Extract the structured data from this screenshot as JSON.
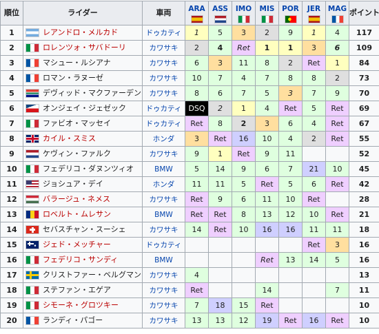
{
  "headers": {
    "pos": "順位",
    "rider": "ライダー",
    "bike": "車両",
    "points": "ポイント",
    "rounds": [
      {
        "label": "ARA",
        "flag": "f-esp",
        "flag_icon": "spain-flag-icon"
      },
      {
        "label": "ASS",
        "flag": "f-nld",
        "flag_icon": "netherlands-flag-icon"
      },
      {
        "label": "IMO",
        "flag": "f-ita",
        "flag_icon": "italy-flag-icon"
      },
      {
        "label": "MIS",
        "flag": "f-ita",
        "flag_icon": "italy-flag-icon"
      },
      {
        "label": "POR",
        "flag": "f-prt",
        "flag_icon": "portugal-flag-icon"
      },
      {
        "label": "JER",
        "flag": "f-esp",
        "flag_icon": "spain-flag-icon"
      },
      {
        "label": "MAG",
        "flag": "f-fra",
        "flag_icon": "france-flag-icon"
      }
    ]
  },
  "rows": [
    {
      "pos": "1",
      "flag": "f-arg",
      "flag_icon": "argentina-flag-icon",
      "rider": "レアンドロ・メルカド",
      "link": "link",
      "bike": "ドゥカティ",
      "points": "117",
      "results": [
        {
          "v": "1",
          "c": "c-gold",
          "s": "i"
        },
        {
          "v": "5",
          "c": "c-pts"
        },
        {
          "v": "3",
          "c": "c-bronze"
        },
        {
          "v": "2",
          "c": "c-silver"
        },
        {
          "v": "9",
          "c": "c-pts"
        },
        {
          "v": "1",
          "c": "c-gold",
          "s": "i"
        },
        {
          "v": "4",
          "c": "c-pts"
        }
      ]
    },
    {
      "pos": "2",
      "flag": "f-ita",
      "flag_icon": "italy-flag-icon",
      "rider": "ロレンツォ・サバドーリ",
      "link": "link",
      "bike": "カワサキ",
      "points": "109",
      "results": [
        {
          "v": "2",
          "c": "c-silver"
        },
        {
          "v": "4",
          "c": "c-pts",
          "s": "b"
        },
        {
          "v": "Ret",
          "c": "c-ret",
          "s": "i"
        },
        {
          "v": "1",
          "c": "c-gold",
          "s": "b"
        },
        {
          "v": "1",
          "c": "c-gold",
          "s": "b"
        },
        {
          "v": "3",
          "c": "c-bronze"
        },
        {
          "v": "6",
          "c": "c-pts",
          "s": "b i"
        }
      ]
    },
    {
      "pos": "3",
      "flag": "f-fra",
      "flag_icon": "france-flag-icon",
      "rider": "マシュー・ルシアナ",
      "link": "plain",
      "bike": "カワサキ",
      "points": "84",
      "results": [
        {
          "v": "6",
          "c": "c-pts"
        },
        {
          "v": "3",
          "c": "c-bronze"
        },
        {
          "v": "11",
          "c": "c-pts"
        },
        {
          "v": "8",
          "c": "c-pts"
        },
        {
          "v": "2",
          "c": "c-silver"
        },
        {
          "v": "Ret",
          "c": "c-ret"
        },
        {
          "v": "1",
          "c": "c-gold"
        }
      ]
    },
    {
      "pos": "4",
      "flag": "f-fra",
      "flag_icon": "france-flag-icon",
      "rider": "ロマン・ラヌーゼ",
      "link": "plain",
      "bike": "カワサキ",
      "points": "73",
      "results": [
        {
          "v": "10",
          "c": "c-pts"
        },
        {
          "v": "7",
          "c": "c-pts"
        },
        {
          "v": "4",
          "c": "c-pts"
        },
        {
          "v": "7",
          "c": "c-pts"
        },
        {
          "v": "8",
          "c": "c-pts"
        },
        {
          "v": "8",
          "c": "c-pts"
        },
        {
          "v": "2",
          "c": "c-silver"
        }
      ]
    },
    {
      "pos": "5",
      "flag": "f-zaf",
      "flag_icon": "south-africa-flag-icon",
      "rider": "デヴィッド・マクファーデン",
      "link": "plain",
      "bike": "カワサキ",
      "points": "70",
      "results": [
        {
          "v": "8",
          "c": "c-pts"
        },
        {
          "v": "6",
          "c": "c-pts"
        },
        {
          "v": "7",
          "c": "c-pts"
        },
        {
          "v": "5",
          "c": "c-pts"
        },
        {
          "v": "3",
          "c": "c-bronze",
          "s": "i"
        },
        {
          "v": "7",
          "c": "c-pts"
        },
        {
          "v": "9",
          "c": "c-pts"
        }
      ]
    },
    {
      "pos": "6",
      "flag": "f-cze",
      "flag_icon": "czech-flag-icon",
      "rider": "オンジェイ・ジェゼック",
      "link": "plain",
      "bike": "ドゥカティ",
      "points": "69",
      "results": [
        {
          "v": "DSQ",
          "c": "c-dsq"
        },
        {
          "v": "2",
          "c": "c-silver",
          "s": "i"
        },
        {
          "v": "1",
          "c": "c-gold"
        },
        {
          "v": "4",
          "c": "c-pts"
        },
        {
          "v": "Ret",
          "c": "c-ret"
        },
        {
          "v": "5",
          "c": "c-pts"
        },
        {
          "v": "Ret",
          "c": "c-ret"
        }
      ]
    },
    {
      "pos": "7",
      "flag": "f-ita",
      "flag_icon": "italy-flag-icon",
      "rider": "ファビオ・マッセイ",
      "link": "plain",
      "bike": "ドゥカティ",
      "points": "67",
      "results": [
        {
          "v": "Ret",
          "c": "c-ret"
        },
        {
          "v": "8",
          "c": "c-pts"
        },
        {
          "v": "2",
          "c": "c-silver",
          "s": "b"
        },
        {
          "v": "3",
          "c": "c-bronze"
        },
        {
          "v": "6",
          "c": "c-pts"
        },
        {
          "v": "4",
          "c": "c-pts"
        },
        {
          "v": "Ret",
          "c": "c-ret"
        }
      ]
    },
    {
      "pos": "8",
      "flag": "f-gbr",
      "flag_icon": "uk-flag-icon",
      "rider": "カイル・スミス",
      "link": "link",
      "bike": "ホンダ",
      "points": "55",
      "results": [
        {
          "v": "3",
          "c": "c-bronze"
        },
        {
          "v": "Ret",
          "c": "c-ret"
        },
        {
          "v": "16",
          "c": "c-nopts"
        },
        {
          "v": "10",
          "c": "c-pts"
        },
        {
          "v": "4",
          "c": "c-pts"
        },
        {
          "v": "2",
          "c": "c-silver"
        },
        {
          "v": "Ret",
          "c": "c-ret"
        }
      ]
    },
    {
      "pos": "9",
      "flag": "f-nld",
      "flag_icon": "netherlands-flag-icon",
      "rider": "ケヴィン・ファルク",
      "link": "plain",
      "bike": "カワサキ",
      "points": "52",
      "results": [
        {
          "v": "9",
          "c": "c-pts"
        },
        {
          "v": "1",
          "c": "c-gold"
        },
        {
          "v": "Ret",
          "c": "c-ret"
        },
        {
          "v": "9",
          "c": "c-pts"
        },
        {
          "v": "11",
          "c": "c-pts"
        },
        {
          "v": "",
          "c": "c-none"
        },
        {
          "v": "",
          "c": "c-none"
        }
      ]
    },
    {
      "pos": "10",
      "flag": "f-ita",
      "flag_icon": "italy-flag-icon",
      "rider": "フェデリコ・ダヌンツィオ",
      "link": "plain",
      "bike": "BMW",
      "points": "45",
      "results": [
        {
          "v": "5",
          "c": "c-pts"
        },
        {
          "v": "14",
          "c": "c-pts"
        },
        {
          "v": "9",
          "c": "c-pts"
        },
        {
          "v": "6",
          "c": "c-pts"
        },
        {
          "v": "7",
          "c": "c-pts"
        },
        {
          "v": "21",
          "c": "c-nopts"
        },
        {
          "v": "10",
          "c": "c-pts"
        }
      ]
    },
    {
      "pos": "11",
      "flag": "f-usa",
      "flag_icon": "usa-flag-icon",
      "rider": "ジョシュア・デイ",
      "link": "plain",
      "bike": "ホンダ",
      "points": "42",
      "results": [
        {
          "v": "11",
          "c": "c-pts"
        },
        {
          "v": "11",
          "c": "c-pts"
        },
        {
          "v": "5",
          "c": "c-pts"
        },
        {
          "v": "Ret",
          "c": "c-ret"
        },
        {
          "v": "5",
          "c": "c-pts"
        },
        {
          "v": "6",
          "c": "c-pts"
        },
        {
          "v": "Ret",
          "c": "c-ret"
        }
      ]
    },
    {
      "pos": "12",
      "flag": "f-hun",
      "flag_icon": "hungary-flag-icon",
      "rider": "バラージュ・ネメス",
      "link": "link",
      "bike": "カワサキ",
      "points": "28",
      "results": [
        {
          "v": "Ret",
          "c": "c-ret"
        },
        {
          "v": "9",
          "c": "c-pts"
        },
        {
          "v": "6",
          "c": "c-pts"
        },
        {
          "v": "11",
          "c": "c-pts"
        },
        {
          "v": "10",
          "c": "c-pts"
        },
        {
          "v": "Ret",
          "c": "c-ret"
        },
        {
          "v": "",
          "c": "c-none"
        }
      ]
    },
    {
      "pos": "13",
      "flag": "f-rou",
      "flag_icon": "romania-flag-icon",
      "rider": "ロベルト・ムレサン",
      "link": "link",
      "bike": "BMW",
      "points": "21",
      "results": [
        {
          "v": "Ret",
          "c": "c-ret"
        },
        {
          "v": "Ret",
          "c": "c-ret"
        },
        {
          "v": "8",
          "c": "c-pts"
        },
        {
          "v": "13",
          "c": "c-pts"
        },
        {
          "v": "12",
          "c": "c-pts"
        },
        {
          "v": "10",
          "c": "c-pts"
        },
        {
          "v": "Ret",
          "c": "c-ret"
        }
      ]
    },
    {
      "pos": "14",
      "flag": "f-che",
      "flag_icon": "switzerland-flag-icon",
      "rider": "セバスチャン・スーシェ",
      "link": "plain",
      "bike": "カワサキ",
      "points": "18",
      "results": [
        {
          "v": "14",
          "c": "c-pts"
        },
        {
          "v": "Ret",
          "c": "c-ret"
        },
        {
          "v": "10",
          "c": "c-pts"
        },
        {
          "v": "16",
          "c": "c-nopts"
        },
        {
          "v": "16",
          "c": "c-nopts"
        },
        {
          "v": "11",
          "c": "c-pts"
        },
        {
          "v": "11",
          "c": "c-pts"
        }
      ]
    },
    {
      "pos": "15",
      "flag": "f-aus",
      "flag_icon": "australia-flag-icon",
      "rider": "ジェド・メッチャー",
      "link": "link",
      "bike": "ドゥカティ",
      "points": "16",
      "results": [
        {
          "v": "",
          "c": "c-none"
        },
        {
          "v": "",
          "c": "c-none"
        },
        {
          "v": "",
          "c": "c-none"
        },
        {
          "v": "",
          "c": "c-none"
        },
        {
          "v": "",
          "c": "c-none"
        },
        {
          "v": "Ret",
          "c": "c-ret"
        },
        {
          "v": "3",
          "c": "c-bronze"
        }
      ]
    },
    {
      "pos": "16",
      "flag": "f-ita",
      "flag_icon": "italy-flag-icon",
      "rider": "フェデリコ・サンディ",
      "link": "link",
      "bike": "BMW",
      "points": "16",
      "results": [
        {
          "v": "",
          "c": "c-none"
        },
        {
          "v": "",
          "c": "c-none"
        },
        {
          "v": "",
          "c": "c-none"
        },
        {
          "v": "Ret",
          "c": "c-ret",
          "s": "i"
        },
        {
          "v": "13",
          "c": "c-pts"
        },
        {
          "v": "14",
          "c": "c-pts"
        },
        {
          "v": "5",
          "c": "c-pts"
        }
      ]
    },
    {
      "pos": "17",
      "flag": "f-swe",
      "flag_icon": "sweden-flag-icon",
      "rider": "クリストファー・ベルグマン",
      "link": "plain",
      "bike": "カワサキ",
      "points": "13",
      "results": [
        {
          "v": "4",
          "c": "c-pts"
        },
        {
          "v": "",
          "c": "c-none"
        },
        {
          "v": "",
          "c": "c-none"
        },
        {
          "v": "",
          "c": "c-none"
        },
        {
          "v": "",
          "c": "c-none"
        },
        {
          "v": "",
          "c": "c-none"
        },
        {
          "v": "",
          "c": "c-none"
        }
      ]
    },
    {
      "pos": "18",
      "flag": "f-ita",
      "flag_icon": "italy-flag-icon",
      "rider": "ステファン・エゲア",
      "link": "plain",
      "bike": "カワサキ",
      "points": "11",
      "results": [
        {
          "v": "Ret",
          "c": "c-ret"
        },
        {
          "v": "",
          "c": "c-none"
        },
        {
          "v": "",
          "c": "c-none"
        },
        {
          "v": "14",
          "c": "c-pts"
        },
        {
          "v": "",
          "c": "c-none"
        },
        {
          "v": "",
          "c": "c-none"
        },
        {
          "v": "7",
          "c": "c-pts"
        }
      ]
    },
    {
      "pos": "19",
      "flag": "f-ita",
      "flag_icon": "italy-flag-icon",
      "rider": "シモーネ・グロツキー",
      "link": "link",
      "bike": "カワサキ",
      "points": "10",
      "results": [
        {
          "v": "7",
          "c": "c-pts"
        },
        {
          "v": "18",
          "c": "c-nopts"
        },
        {
          "v": "15",
          "c": "c-pts"
        },
        {
          "v": "Ret",
          "c": "c-ret"
        },
        {
          "v": "",
          "c": "c-none"
        },
        {
          "v": "",
          "c": "c-none"
        },
        {
          "v": "",
          "c": "c-none"
        }
      ]
    },
    {
      "pos": "20",
      "flag": "f-fra",
      "flag_icon": "france-flag-icon",
      "rider": "ランディ・パゴー",
      "link": "plain",
      "bike": "カワサキ",
      "points": "10",
      "results": [
        {
          "v": "13",
          "c": "c-pts"
        },
        {
          "v": "13",
          "c": "c-pts"
        },
        {
          "v": "12",
          "c": "c-pts"
        },
        {
          "v": "19",
          "c": "c-nopts"
        },
        {
          "v": "Ret",
          "c": "c-ret"
        },
        {
          "v": "16",
          "c": "c-nopts"
        },
        {
          "v": "Ret",
          "c": "c-ret"
        }
      ]
    }
  ]
}
